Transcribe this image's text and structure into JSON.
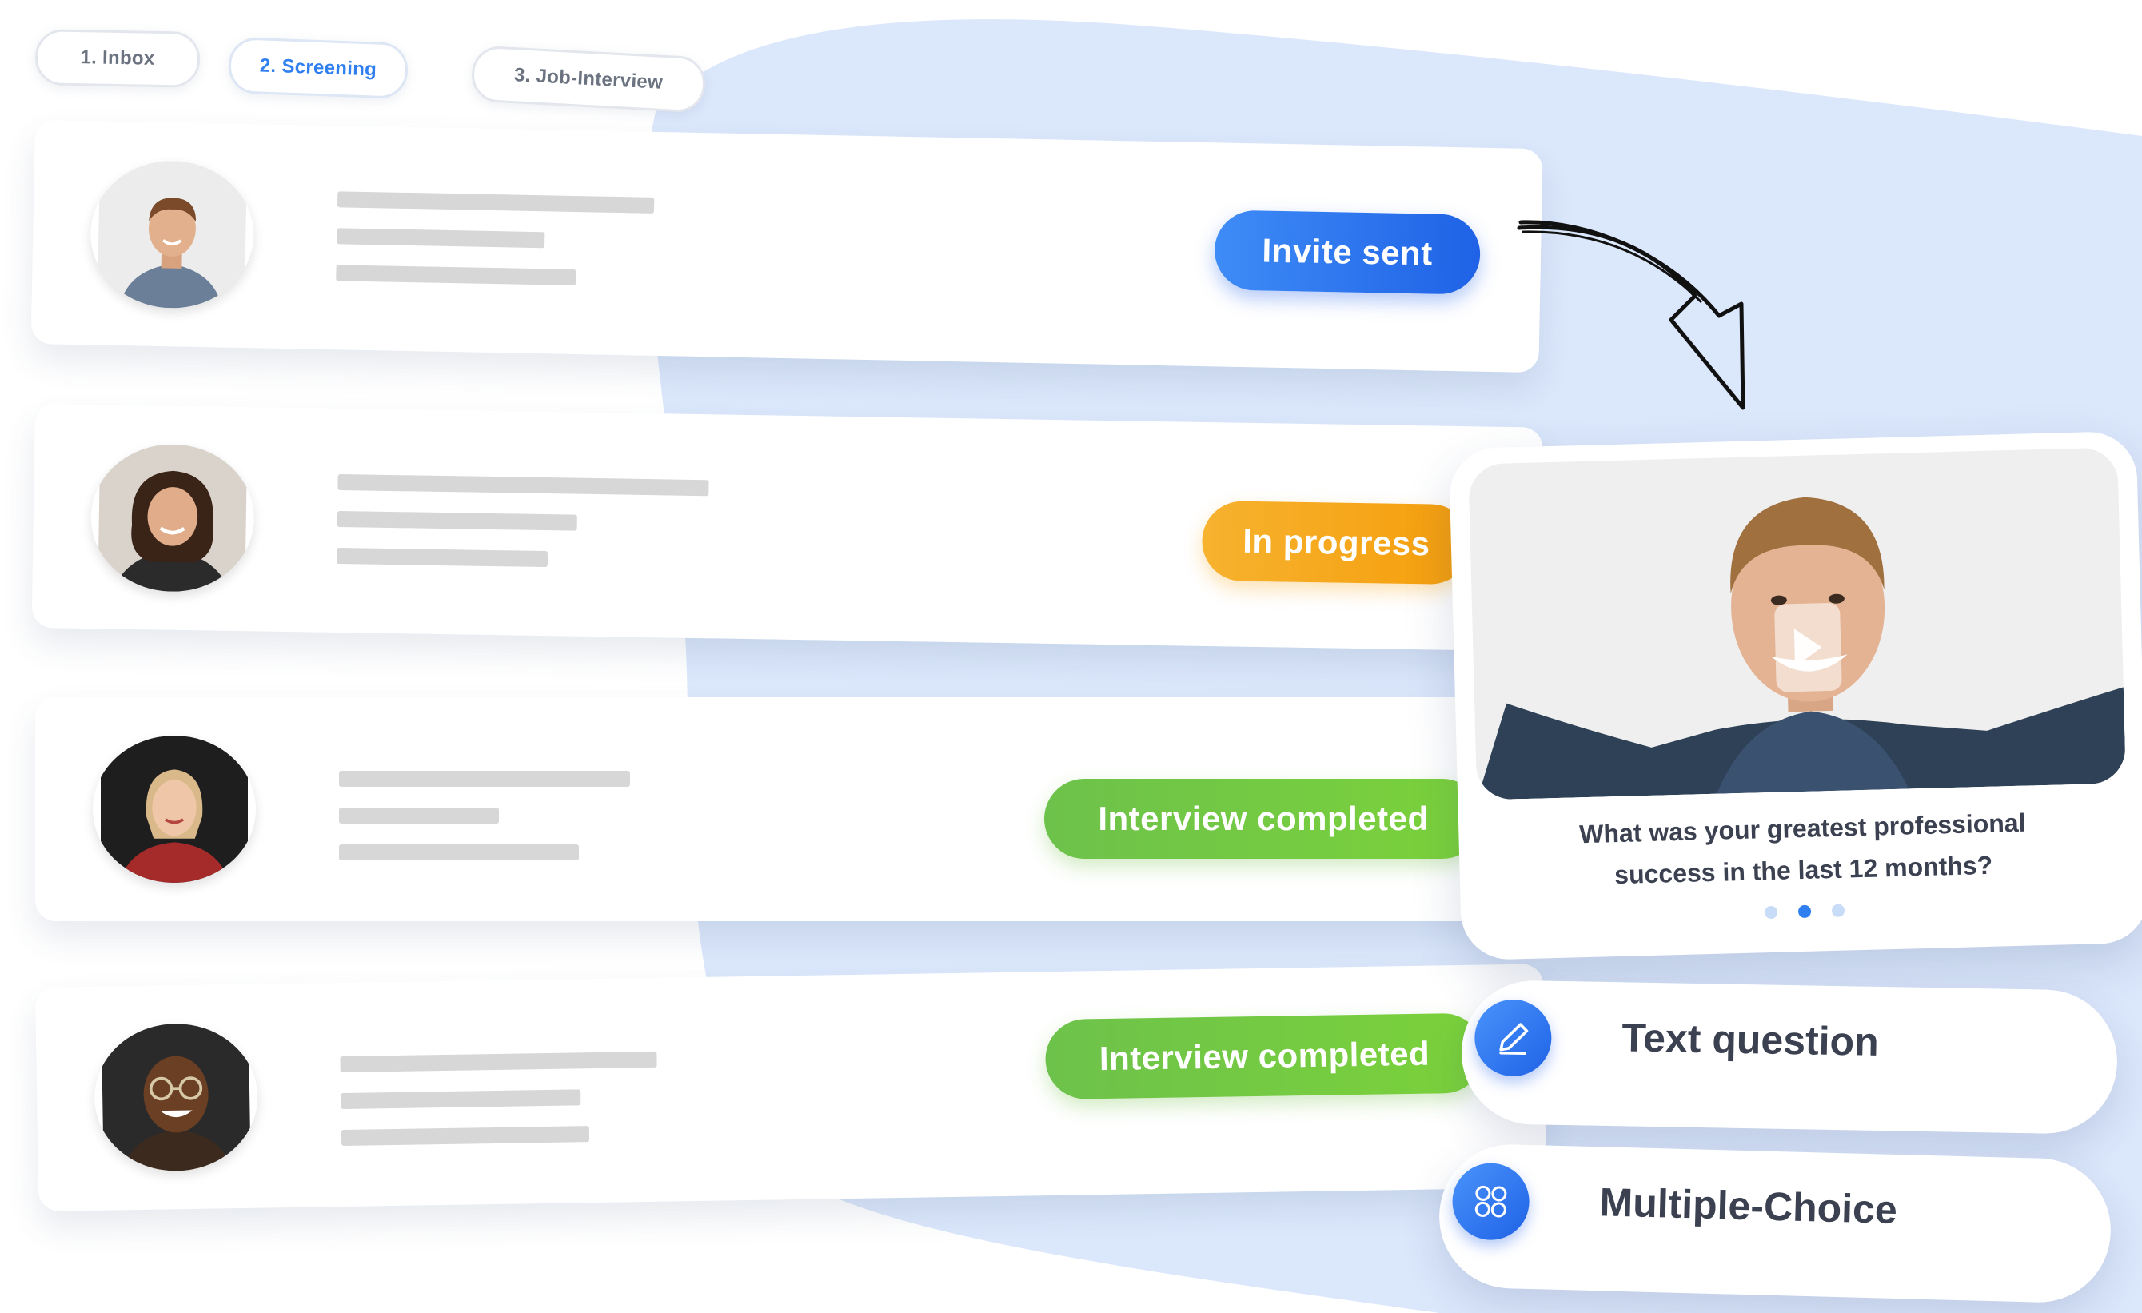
{
  "stage_tabs": [
    {
      "label": "1. Inbox",
      "active": false
    },
    {
      "label": "2. Screening",
      "active": true
    },
    {
      "label": "3. Job-Interview",
      "active": false
    }
  ],
  "candidates": [
    {
      "status": "Invite sent",
      "status_color": "#2563eb"
    },
    {
      "status": "In progress",
      "status_color": "#f59e0b"
    },
    {
      "status": "Interview completed",
      "status_color": "#6ec23f"
    },
    {
      "status": "Interview completed",
      "status_color": "#6ec23f"
    }
  ],
  "video_question": {
    "question_line1": "What was your greatest professional",
    "question_line2": "success in the last 12 months?",
    "pagination": {
      "total": 3,
      "current": 2
    }
  },
  "question_types": [
    {
      "label": "Text question",
      "icon": "pencil-icon"
    },
    {
      "label": "Multiple-Choice",
      "icon": "grid-circles-icon"
    }
  ],
  "colors": {
    "accent_blue": "#2f7ff0",
    "background_blob": "#dbe7fb",
    "text_dark": "#3b4150"
  }
}
